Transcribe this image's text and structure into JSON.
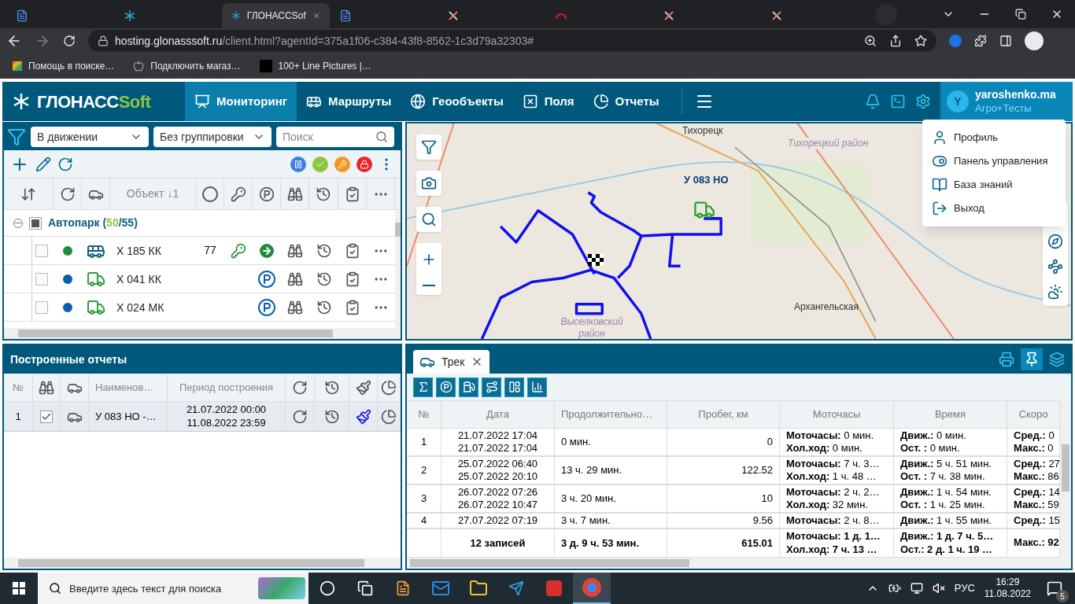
{
  "browser": {
    "tabs": [
      {
        "kind": "doc",
        "selected": false
      },
      {
        "kind": "snowflake",
        "selected": false
      },
      {
        "kind": "snowflake",
        "selected": true,
        "title": "ГЛОНАССSof"
      },
      {
        "kind": "doc",
        "selected": false
      },
      {
        "kind": "star",
        "selected": false
      },
      {
        "kind": "arc",
        "selected": false
      },
      {
        "kind": "star",
        "selected": false
      },
      {
        "kind": "star",
        "selected": false
      }
    ],
    "address": {
      "host": "hosting.glonasssoft.ru",
      "path": "/client.html?agentId=375a1f06-c384-43f8-8562-1c3d79a32303#"
    },
    "bookmarks": [
      {
        "kind": "rainbow",
        "label": "Помощь в поиске…"
      },
      {
        "kind": "apple",
        "label": "Подключить магаз…"
      },
      {
        "kind": "block",
        "label": "100+ Line Pictures |…"
      }
    ]
  },
  "header": {
    "logo": {
      "main": "ГЛОНАСС",
      "accent": "Soft"
    },
    "nav": [
      {
        "label": "Мониторинг",
        "selected": true
      },
      {
        "label": "Маршруты",
        "selected": false
      },
      {
        "label": "Геообъекты",
        "selected": false
      },
      {
        "label": "Поля",
        "selected": false
      },
      {
        "label": "Отчеты",
        "selected": false
      }
    ],
    "user": {
      "initial": "Y",
      "login": "yaroshenko.ma",
      "account": "Агро+Тесты"
    }
  },
  "user_menu": [
    {
      "kind": "profile",
      "label": "Профиль"
    },
    {
      "kind": "panel",
      "label": "Панель управления"
    },
    {
      "kind": "book",
      "label": "База знаний"
    },
    {
      "kind": "exit",
      "label": "Выход"
    }
  ],
  "monitoring": {
    "filters": {
      "state": "В движении",
      "grouping": "Без группировки",
      "search_placeholder": "Поиск"
    },
    "object_header": "Объект ↓1",
    "group": {
      "indeterminate": true,
      "parts": [
        {
          "kind": "name",
          "text": "Автопарк ("
        },
        {
          "kind": "online",
          "text": "50"
        },
        {
          "kind": "name",
          "text": "/55)"
        }
      ]
    },
    "rows": [
      {
        "checked": false,
        "color": "#1e8c3a",
        "kind": "bus",
        "name": "Х 185 КК",
        "speed": "77",
        "key": true,
        "moving": true
      },
      {
        "checked": false,
        "color": "#0b5fb3",
        "kind": "truck",
        "name": "Х 041 КК",
        "key": false,
        "moving": false
      },
      {
        "checked": false,
        "color": "#0b5fb3",
        "kind": "truck",
        "name": "Х 024 МК",
        "key": false,
        "moving": false
      }
    ]
  },
  "map": {
    "labels": [
      {
        "text": "Тихорецк",
        "kind": "town"
      },
      {
        "text": "Тихорецкий район",
        "kind": "district"
      },
      {
        "text": "Архангельская",
        "kind": "town"
      },
      {
        "text": "Выселковский район",
        "kind": "district"
      }
    ],
    "marker": "У 083 НО"
  },
  "reports": {
    "title": "Построенные отчеты",
    "columns": [
      "№",
      "Наименов…",
      "Период построения"
    ],
    "rows": [
      {
        "num": "1",
        "checked": true,
        "name": "У 083 НО -…",
        "from": "21.07.2022 00:00",
        "to": "11.08.2022 23:59"
      }
    ]
  },
  "track": {
    "tab": "Трек",
    "columns": [
      "№",
      "Дата",
      "Продолжительно…",
      "Пробег, км",
      "Моточасы",
      "Время",
      "Скоро"
    ],
    "rows": [
      {
        "num": "1",
        "date": [
          "21.07.2022 17:04",
          "21.07.2022 17:04"
        ],
        "duration": "0 мин.",
        "mileage": "0",
        "moto": [
          "**Моточасы:** 0 мин.",
          "**Хол.ход:** 0 мин."
        ],
        "time": [
          "**Движ.:** 0 мин.",
          "**Ост. :** 0 мин."
        ],
        "speed": [
          "**Сред.:** 0",
          "**Макс.:** 0"
        ]
      },
      {
        "num": "2",
        "date": [
          "25.07.2022 06:40",
          "25.07.2022 20:10"
        ],
        "duration": "13 ч. 29 мин.",
        "mileage": "122.52",
        "moto": [
          "**Моточасы:** 7 ч. 3…",
          "**Хол.ход:** 1 ч. 48 …"
        ],
        "time": [
          "**Движ.:** 5 ч. 51 мин.",
          "**Ост. :** 7 ч. 38 мин."
        ],
        "speed": [
          "**Сред.:** 27",
          "**Макс.:** 86"
        ]
      },
      {
        "num": "3",
        "date": [
          "26.07.2022 07:26",
          "26.07.2022 10:47"
        ],
        "duration": "3 ч. 20 мин.",
        "mileage": "10",
        "moto": [
          "**Моточасы:** 2 ч. 2…",
          "**Хол.ход:** 32 мин."
        ],
        "time": [
          "**Движ.:** 1 ч. 54 мин.",
          "**Ост. :** 1 ч. 25 мин."
        ],
        "speed": [
          "**Сред.:** 14",
          "**Макс.:** 59"
        ]
      },
      {
        "num": "4",
        "date": [
          "27.07.2022 07:19"
        ],
        "duration": "3 ч. 7 мин.",
        "mileage": "9.56",
        "moto": [
          "**Моточасы:** 2 ч. 8…"
        ],
        "time": [
          "**Движ.:** 1 ч. 55 мин."
        ],
        "speed": [
          "**Сред.:** 15"
        ]
      }
    ],
    "footer": {
      "count": "12 записей",
      "duration": "3 д. 9 ч. 53 мин.",
      "mileage": "615.01",
      "moto": [
        "Моточасы: 1 д. 1…",
        "Хол.ход: 7 ч. 13 …"
      ],
      "time": [
        "Движ.: 1 д. 7 ч. 5…",
        "Ост.: 2 д. 1 ч. 19 …"
      ],
      "speed": [
        "Макс.: 92"
      ]
    }
  },
  "taskbar": {
    "search_placeholder": "Введите здесь текст для поиска",
    "language": "РУС",
    "time": "16:29",
    "date": "11.08.2022",
    "notifications": "5"
  }
}
